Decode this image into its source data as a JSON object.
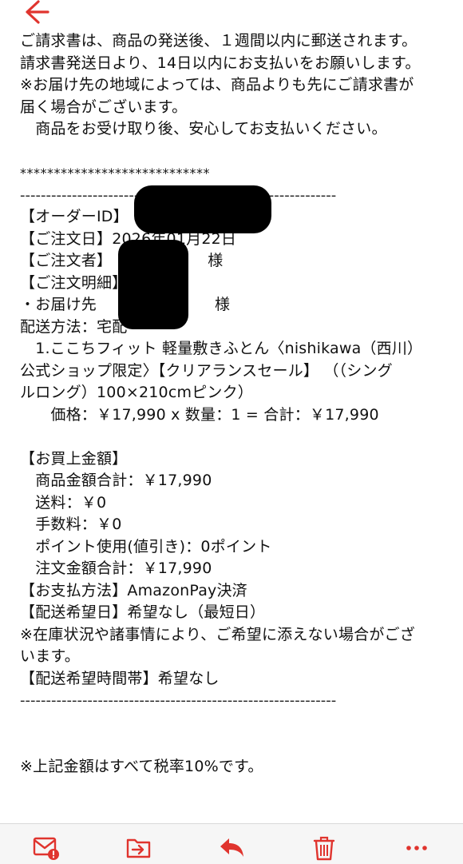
{
  "nav": {
    "back_icon": "back-arrow-icon",
    "accent_color": "#e0342e"
  },
  "message": {
    "lines": [
      "ご請求書は、商品の発送後、１週間以内に郵送されます。",
      "請求書発送日より、14日以内にお支払いをお願いします。",
      "※お届け先の地域によっては、商品よりも先にご請求書が",
      "届く場合がございます。",
      "　商品をお受け取り後、安心してお支払いください。"
    ],
    "stars": "****************************",
    "dashes_top": "-------------------------------------------------------------",
    "order_id_label": "【オーダーID】",
    "order_date_label": "【ご注文日】",
    "order_date": "2026年01月22日",
    "orderer_label": "【ご注文者】",
    "orderer_suffix": "様",
    "order_detail_label": "【ご注文明細】",
    "ship_to_label": "・お届け先",
    "ship_to_suffix": "様",
    "delivery_method": "配送方法：宅配",
    "item_lines": [
      "　1.ここちフィット 軽量敷きふとん〈nishikawa（西川）",
      "公式ショップ限定〉【クリアランスセール】 （（シング",
      "ルロング）100×210cmピンク）"
    ],
    "item_price_line": "　　価格：￥17,990 x 数量：1 = 合計：￥17,990",
    "purchase_total_label": "【お買上金額】",
    "summary_lines": [
      "　商品金額合計：￥17,990",
      "　送料：￥0",
      "　手数料：￥0",
      "　ポイント使用(値引き)：0ポイント",
      "　注文金額合計：￥17,990"
    ],
    "payment_line": "【お支払方法】AmazonPay決済",
    "delivery_date_line": "【配送希望日】希望なし（最短日）",
    "stock_note_lines": [
      "※在庫状況や諸事情により、ご希望に添えない場合がござ",
      "います。"
    ],
    "delivery_time_line": "【配送希望時間帯】希望なし",
    "dashes_bottom": "-------------------------------------------------------------",
    "tax_note": "※上記金額はすべて税率10%です。"
  },
  "toolbar": {
    "items": [
      {
        "name": "mark-icon"
      },
      {
        "name": "move-to-folder-icon"
      },
      {
        "name": "reply-icon"
      },
      {
        "name": "trash-icon"
      },
      {
        "name": "more-icon"
      }
    ],
    "color": "#e0342e"
  }
}
